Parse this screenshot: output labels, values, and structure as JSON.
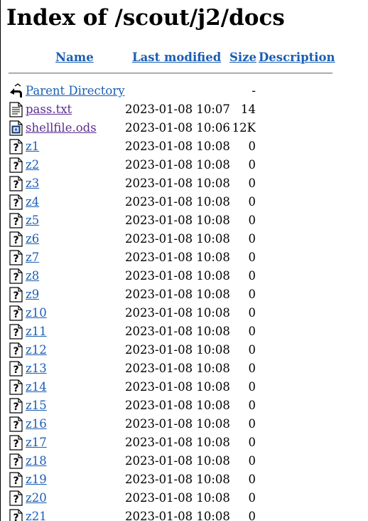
{
  "page": {
    "heading": "Index of /scout/j2/docs"
  },
  "columns": {
    "name": "Name",
    "last_modified": "Last modified",
    "size": "Size",
    "description": "Description"
  },
  "parent": {
    "label": "Parent Directory",
    "size": "-",
    "icon": "back-icon"
  },
  "entries": [
    {
      "name": "pass.txt",
      "modified": "2023-01-08 10:07",
      "size": "14",
      "icon": "text-file-icon",
      "visited": true
    },
    {
      "name": "shellfile.ods",
      "modified": "2023-01-08 10:06",
      "size": "12K",
      "icon": "document-file-icon",
      "visited": true
    },
    {
      "name": "z1",
      "modified": "2023-01-08 10:08",
      "size": "0",
      "icon": "unknown-file-icon",
      "visited": false
    },
    {
      "name": "z2",
      "modified": "2023-01-08 10:08",
      "size": "0",
      "icon": "unknown-file-icon",
      "visited": false
    },
    {
      "name": "z3",
      "modified": "2023-01-08 10:08",
      "size": "0",
      "icon": "unknown-file-icon",
      "visited": false
    },
    {
      "name": "z4",
      "modified": "2023-01-08 10:08",
      "size": "0",
      "icon": "unknown-file-icon",
      "visited": false
    },
    {
      "name": "z5",
      "modified": "2023-01-08 10:08",
      "size": "0",
      "icon": "unknown-file-icon",
      "visited": false
    },
    {
      "name": "z6",
      "modified": "2023-01-08 10:08",
      "size": "0",
      "icon": "unknown-file-icon",
      "visited": false
    },
    {
      "name": "z7",
      "modified": "2023-01-08 10:08",
      "size": "0",
      "icon": "unknown-file-icon",
      "visited": false
    },
    {
      "name": "z8",
      "modified": "2023-01-08 10:08",
      "size": "0",
      "icon": "unknown-file-icon",
      "visited": false
    },
    {
      "name": "z9",
      "modified": "2023-01-08 10:08",
      "size": "0",
      "icon": "unknown-file-icon",
      "visited": false
    },
    {
      "name": "z10",
      "modified": "2023-01-08 10:08",
      "size": "0",
      "icon": "unknown-file-icon",
      "visited": false
    },
    {
      "name": "z11",
      "modified": "2023-01-08 10:08",
      "size": "0",
      "icon": "unknown-file-icon",
      "visited": false
    },
    {
      "name": "z12",
      "modified": "2023-01-08 10:08",
      "size": "0",
      "icon": "unknown-file-icon",
      "visited": false
    },
    {
      "name": "z13",
      "modified": "2023-01-08 10:08",
      "size": "0",
      "icon": "unknown-file-icon",
      "visited": false
    },
    {
      "name": "z14",
      "modified": "2023-01-08 10:08",
      "size": "0",
      "icon": "unknown-file-icon",
      "visited": false
    },
    {
      "name": "z15",
      "modified": "2023-01-08 10:08",
      "size": "0",
      "icon": "unknown-file-icon",
      "visited": false
    },
    {
      "name": "z16",
      "modified": "2023-01-08 10:08",
      "size": "0",
      "icon": "unknown-file-icon",
      "visited": false
    },
    {
      "name": "z17",
      "modified": "2023-01-08 10:08",
      "size": "0",
      "icon": "unknown-file-icon",
      "visited": false
    },
    {
      "name": "z18",
      "modified": "2023-01-08 10:08",
      "size": "0",
      "icon": "unknown-file-icon",
      "visited": false
    },
    {
      "name": "z19",
      "modified": "2023-01-08 10:08",
      "size": "0",
      "icon": "unknown-file-icon",
      "visited": false
    },
    {
      "name": "z20",
      "modified": "2023-01-08 10:08",
      "size": "0",
      "icon": "unknown-file-icon",
      "visited": false
    },
    {
      "name": "z21",
      "modified": "2023-01-08 10:08",
      "size": "0",
      "icon": "unknown-file-icon",
      "visited": false
    }
  ],
  "colors": {
    "link": "#1a5fb4",
    "visited": "#5c2d91",
    "text": "#000000"
  }
}
